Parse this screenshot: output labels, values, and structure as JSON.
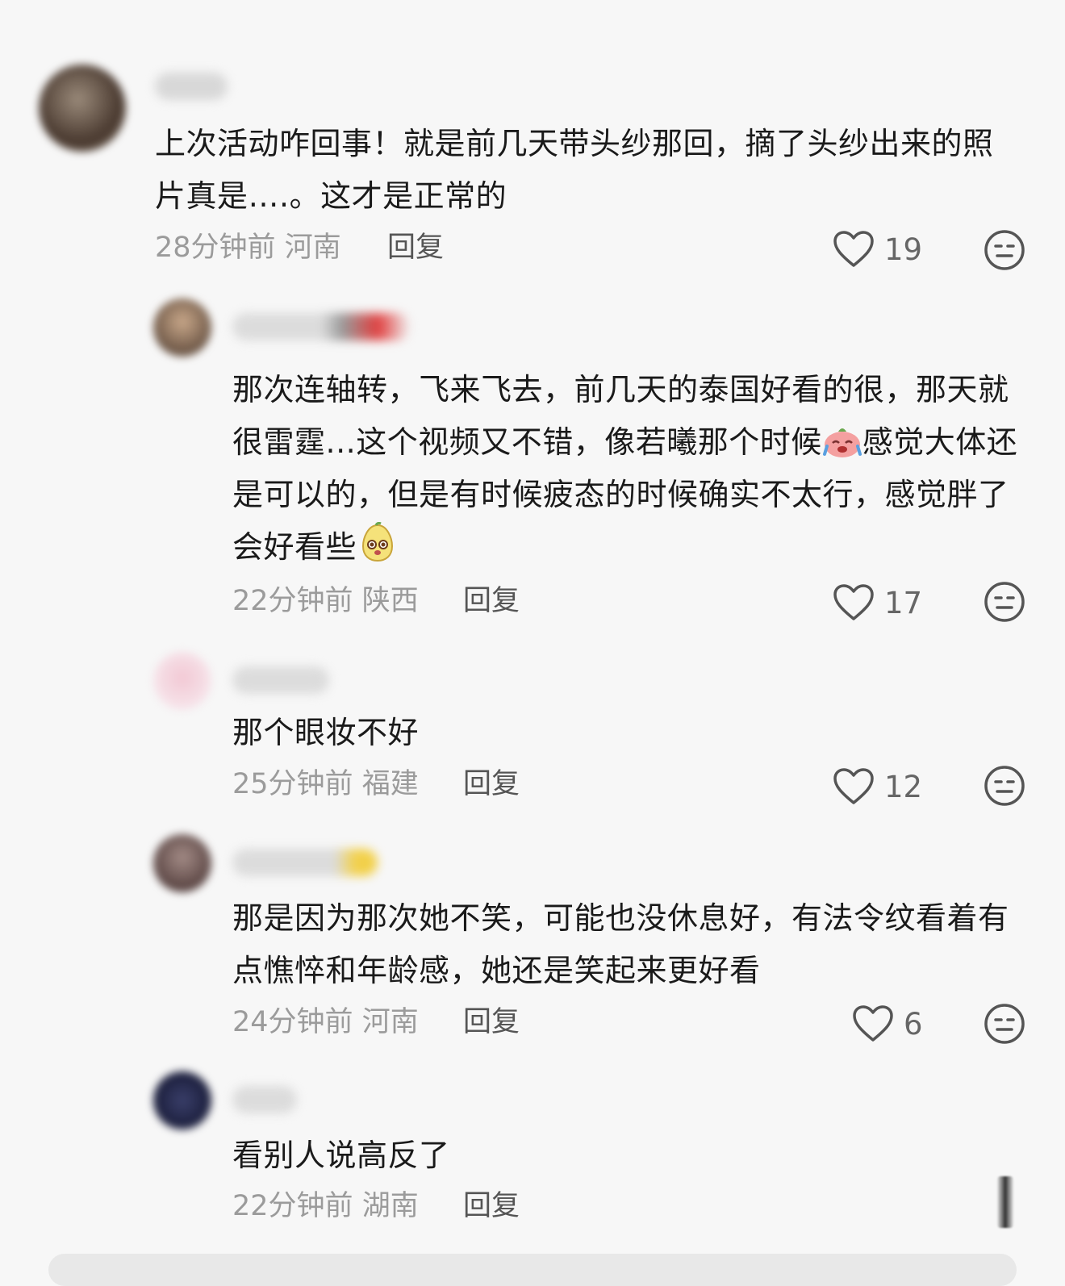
{
  "comments": [
    {
      "text": "上次活动咋回事！就是前几天带头纱那回，摘了头纱出来的照片真是….。这才是正常的",
      "time": "28分钟前",
      "location": "河南",
      "reply_label": "回复",
      "likes": "19"
    },
    {
      "text_parts": [
        "那次连轴转，飞来飞去，前几天的泰国好看的很，那天就很雷霆...这个视频又不错，像若曦那个时候",
        "感觉大体还是可以的，但是有时候疲态的时候确实不太行，感觉胖了会好看些"
      ],
      "emojis": [
        "crying-laugh-emoji",
        "pear-face-emoji"
      ],
      "time": "22分钟前",
      "location": "陕西",
      "reply_label": "回复",
      "likes": "17"
    },
    {
      "text": "那个眼妆不好",
      "time": "25分钟前",
      "location": "福建",
      "reply_label": "回复",
      "likes": "12"
    },
    {
      "text": "那是因为那次她不笑，可能也没休息好，有法令纹看着有点憔悴和年龄感，她还是笑起来更好看",
      "time": "24分钟前",
      "location": "河南",
      "reply_label": "回复",
      "likes": "6"
    },
    {
      "text": "看别人说高反了",
      "time": "22分钟前",
      "location": "湖南",
      "reply_label": "回复"
    }
  ],
  "icons": {
    "like": "heart-outline-icon",
    "dislike": "neutral-face-icon"
  },
  "colors": {
    "background": "#f7f7f7",
    "text": "#1a1a1a",
    "meta": "#9b9b9b"
  }
}
